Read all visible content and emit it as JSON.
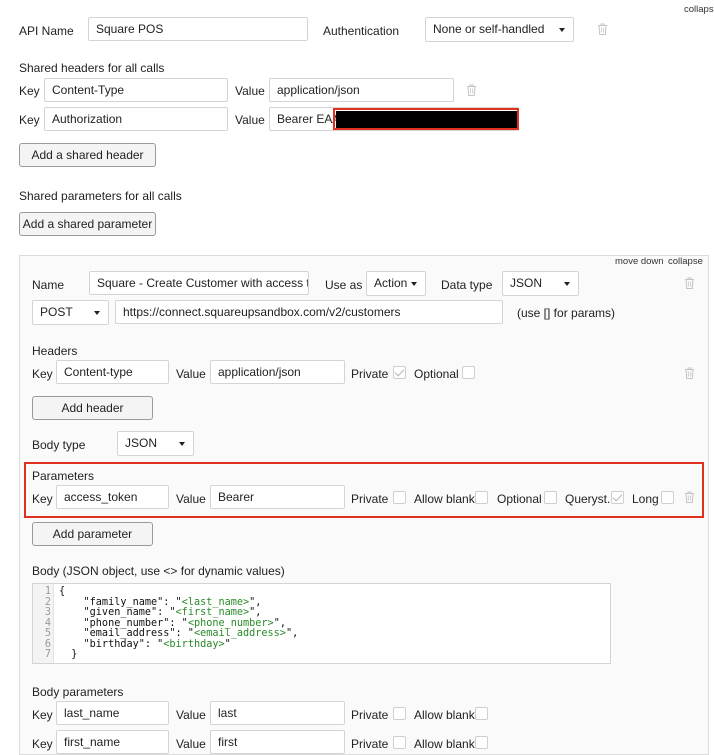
{
  "top": {
    "collapse": "collapse",
    "api_name_label": "API Name",
    "api_name_value": "Square POS",
    "auth_label": "Authentication",
    "auth_value": "None or self-handled"
  },
  "shared_headers": {
    "title": "Shared headers for all calls",
    "rows": [
      {
        "key_label": "Key",
        "key": "Content-Type",
        "value_label": "Value",
        "value": "application/json"
      },
      {
        "key_label": "Key",
        "key": "Authorization",
        "value_label": "Value",
        "value": "Bearer EAA"
      }
    ],
    "add_button": "Add a shared header"
  },
  "shared_params": {
    "title": "Shared parameters for all calls",
    "add_button": "Add a shared parameter"
  },
  "call": {
    "move_down": "move down",
    "collapse": "collapse",
    "name_label": "Name",
    "name_value": "Square - Create Customer with access toke",
    "use_as_label": "Use as",
    "use_as_value": "Action",
    "data_type_label": "Data type",
    "data_type_value": "JSON",
    "method": "POST",
    "url": "https://connect.squareupsandbox.com/v2/customers",
    "url_hint": "(use [] for params)",
    "headers_title": "Headers",
    "header_row": {
      "key_label": "Key",
      "key": "Content-type",
      "value_label": "Value",
      "value": "application/json",
      "private_label": "Private",
      "private_checked": true,
      "optional_label": "Optional",
      "optional_checked": false
    },
    "add_header_button": "Add header",
    "body_type_label": "Body type",
    "body_type_value": "JSON",
    "params_title": "Parameters",
    "param_row": {
      "key_label": "Key",
      "key": "access_token",
      "value_label": "Value",
      "value": "Bearer",
      "private_label": "Private",
      "private_checked": false,
      "allow_blank_label": "Allow blank",
      "allow_blank_checked": false,
      "optional_label": "Optional",
      "optional_checked": false,
      "queryst_label": "Queryst.",
      "queryst_checked": true,
      "long_label": "Long",
      "long_checked": false
    },
    "add_param_button": "Add parameter",
    "body_label": "Body (JSON object, use <> for dynamic values)",
    "body_lines": [
      {
        "n": "1",
        "pre": "{",
        "dyn": "",
        "post": ""
      },
      {
        "n": "2",
        "pre": "    \"family_name\": \"",
        "dyn": "<last_name>",
        "post": "\","
      },
      {
        "n": "3",
        "pre": "    \"given_name\": \"",
        "dyn": "<first_name>",
        "post": "\","
      },
      {
        "n": "4",
        "pre": "    \"phone_number\": \"",
        "dyn": "<phone_number>",
        "post": "\","
      },
      {
        "n": "5",
        "pre": "    \"email_address\": \"",
        "dyn": "<email_address>",
        "post": "\","
      },
      {
        "n": "6",
        "pre": "    \"birthday\": \"",
        "dyn": "<birthday>",
        "post": "\""
      },
      {
        "n": "7",
        "pre": "  }",
        "dyn": "",
        "post": ""
      }
    ],
    "body_params_title": "Body parameters",
    "body_param_rows": [
      {
        "key_label": "Key",
        "key": "last_name",
        "value_label": "Value",
        "value": "last",
        "private_label": "Private",
        "allow_blank_label": "Allow blank"
      },
      {
        "key_label": "Key",
        "key": "first_name",
        "value_label": "Value",
        "value": "first",
        "private_label": "Private",
        "allow_blank_label": "Allow blank"
      }
    ]
  },
  "icons": {
    "trash": "trash-icon",
    "dropdown": "chevron-down-icon",
    "check": "check-icon"
  },
  "colors": {
    "highlight": "#e0301e",
    "redacted": "#000000",
    "dynamic_value": "#2b8a2b"
  }
}
